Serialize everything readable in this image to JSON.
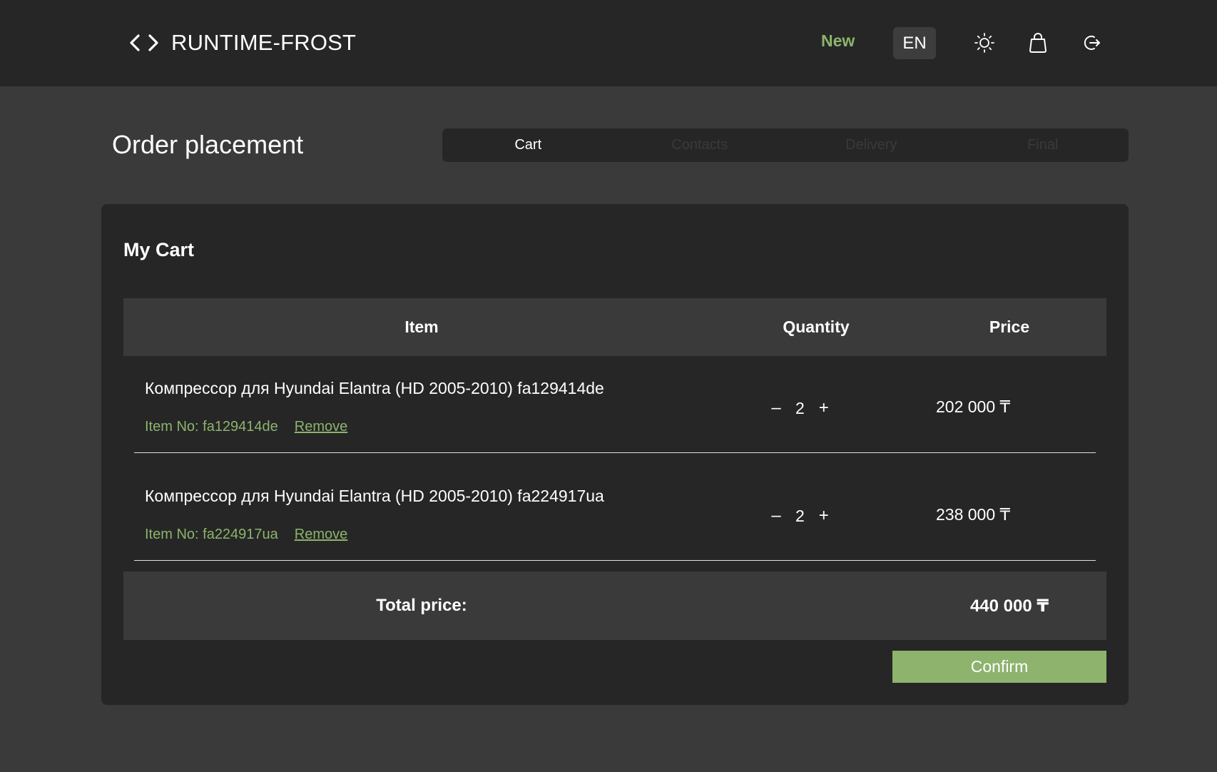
{
  "header": {
    "brand": "RUNTIME-FROST",
    "brand_icon": "code-brackets-icon",
    "new_label": "New",
    "language": "EN",
    "icons": [
      "sun-icon",
      "shopping-bag-icon",
      "logout-icon"
    ]
  },
  "page": {
    "title": "Order placement",
    "steps": [
      {
        "label": "Cart",
        "active": true
      },
      {
        "label": "Contacts",
        "active": false
      },
      {
        "label": "Delivery",
        "active": false
      },
      {
        "label": "Final",
        "active": false
      }
    ]
  },
  "cart": {
    "title": "My Cart",
    "columns": {
      "item": "Item",
      "quantity": "Quantity",
      "price": "Price"
    },
    "rows": [
      {
        "name": "Компрессор для Hyundai Elantra (HD 2005-2010) fa129414de",
        "item_no": "Item No: fa129414de",
        "remove": "Remove",
        "quantity": "2",
        "price": "202 000 ₸"
      },
      {
        "name": "Компрессор для Hyundai Elantra (HD 2005-2010) fa224917ua",
        "item_no": "Item No: fa224917ua",
        "remove": "Remove",
        "quantity": "2",
        "price": "238 000 ₸"
      }
    ],
    "qty_minus": "–",
    "qty_plus": "+",
    "total_label": "Total price:",
    "total_value": "440 000 ₸",
    "confirm_label": "Confirm"
  },
  "colors": {
    "accent": "#8db36d",
    "header_bg": "#262626",
    "page_bg": "#3a3a3a",
    "card_bg": "#262626"
  }
}
